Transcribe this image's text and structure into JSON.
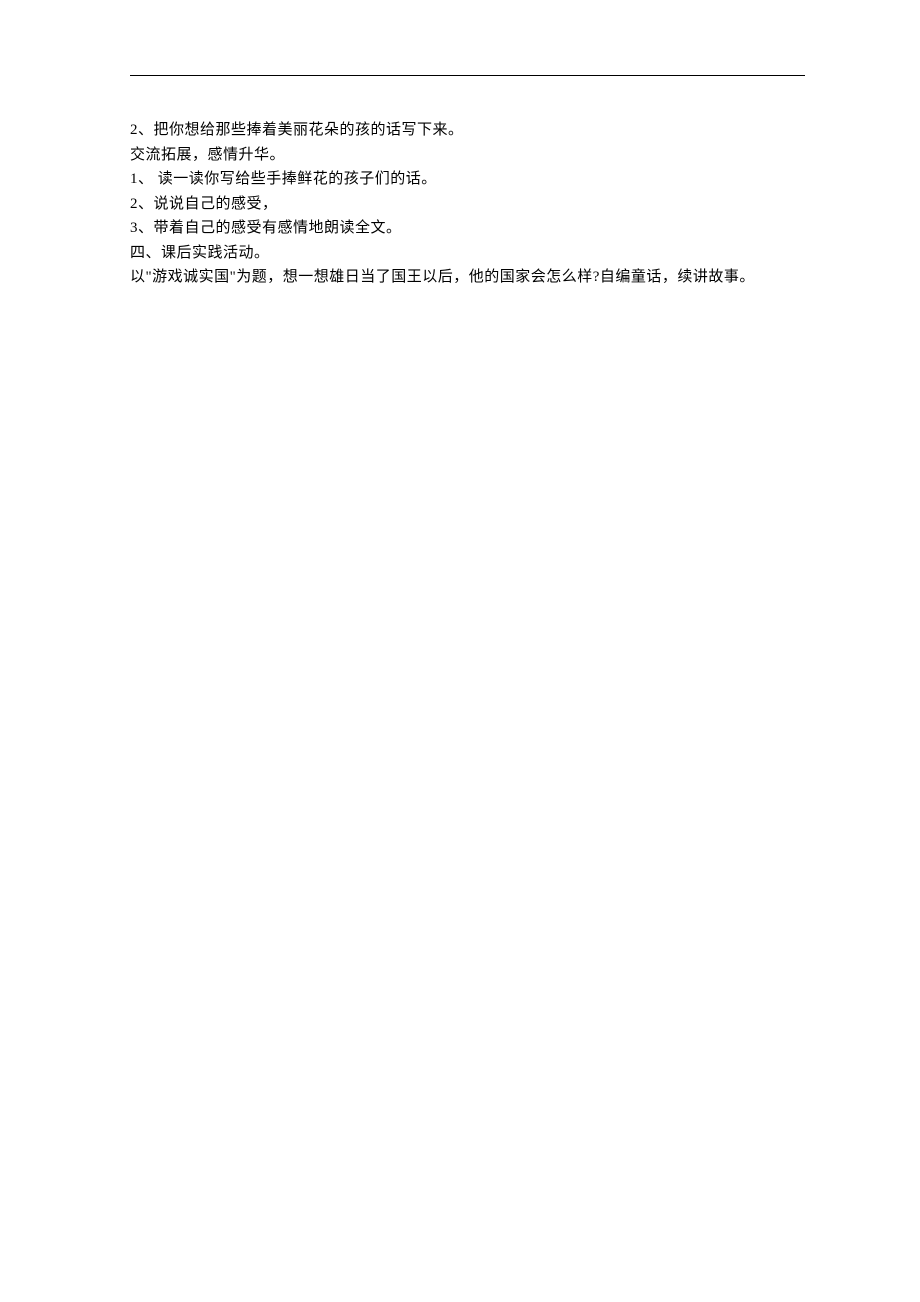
{
  "lines": [
    "2、把你想给那些捧着美丽花朵的孩的话写下来。",
    "交流拓展，感情升华。",
    "1、 读一读你写给些手捧鲜花的孩子们的话。",
    "2、说说自己的感受，",
    "3、带着自己的感受有感情地朗读全文。",
    "四、课后实践活动。",
    "以\"游戏诚实国\"为题，想一想雄日当了国王以后，他的国家会怎么样?自编童话，续讲故事。"
  ]
}
